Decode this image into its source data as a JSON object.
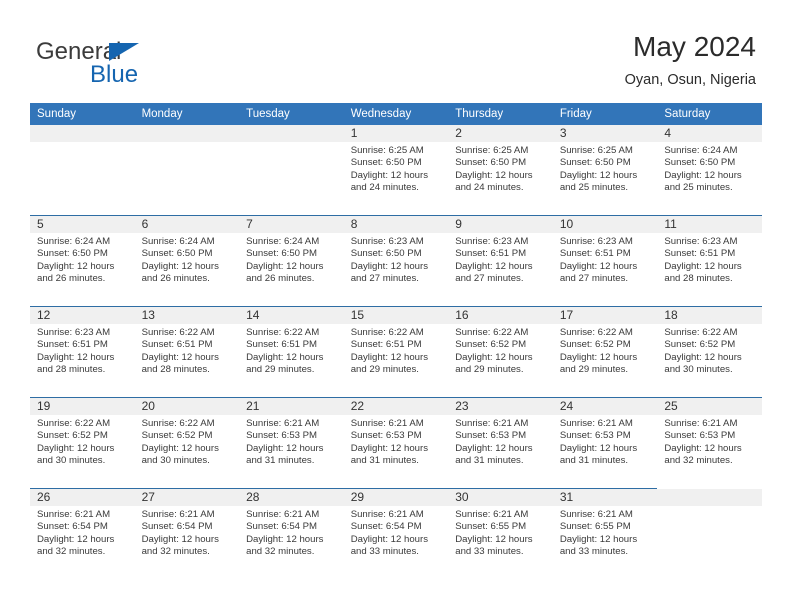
{
  "brand": {
    "word_one": "General",
    "word_two": "Blue",
    "triangle_icon": "triangle-icon",
    "color_blue": "#1565b0"
  },
  "header": {
    "title": "May 2024",
    "subtitle": "Oyan, Osun, Nigeria"
  },
  "theme": {
    "header_bar": "#3275b9",
    "row_divider": "#2e6da4",
    "daynum_band": "#f0f0f0",
    "text": "#3a3a3a"
  },
  "weekdays": [
    "Sunday",
    "Monday",
    "Tuesday",
    "Wednesday",
    "Thursday",
    "Friday",
    "Saturday"
  ],
  "weeks": [
    [
      {
        "day": "",
        "empty": true,
        "sunrise": "",
        "sunset": "",
        "daylight_line1": "",
        "daylight_line2": ""
      },
      {
        "day": "",
        "empty": true,
        "sunrise": "",
        "sunset": "",
        "daylight_line1": "",
        "daylight_line2": ""
      },
      {
        "day": "",
        "empty": true,
        "sunrise": "",
        "sunset": "",
        "daylight_line1": "",
        "daylight_line2": ""
      },
      {
        "day": "1",
        "empty": false,
        "sunrise": "Sunrise: 6:25 AM",
        "sunset": "Sunset: 6:50 PM",
        "daylight_line1": "Daylight: 12 hours",
        "daylight_line2": "and 24 minutes."
      },
      {
        "day": "2",
        "empty": false,
        "sunrise": "Sunrise: 6:25 AM",
        "sunset": "Sunset: 6:50 PM",
        "daylight_line1": "Daylight: 12 hours",
        "daylight_line2": "and 24 minutes."
      },
      {
        "day": "3",
        "empty": false,
        "sunrise": "Sunrise: 6:25 AM",
        "sunset": "Sunset: 6:50 PM",
        "daylight_line1": "Daylight: 12 hours",
        "daylight_line2": "and 25 minutes."
      },
      {
        "day": "4",
        "empty": false,
        "sunrise": "Sunrise: 6:24 AM",
        "sunset": "Sunset: 6:50 PM",
        "daylight_line1": "Daylight: 12 hours",
        "daylight_line2": "and 25 minutes."
      }
    ],
    [
      {
        "day": "5",
        "empty": false,
        "sunrise": "Sunrise: 6:24 AM",
        "sunset": "Sunset: 6:50 PM",
        "daylight_line1": "Daylight: 12 hours",
        "daylight_line2": "and 26 minutes."
      },
      {
        "day": "6",
        "empty": false,
        "sunrise": "Sunrise: 6:24 AM",
        "sunset": "Sunset: 6:50 PM",
        "daylight_line1": "Daylight: 12 hours",
        "daylight_line2": "and 26 minutes."
      },
      {
        "day": "7",
        "empty": false,
        "sunrise": "Sunrise: 6:24 AM",
        "sunset": "Sunset: 6:50 PM",
        "daylight_line1": "Daylight: 12 hours",
        "daylight_line2": "and 26 minutes."
      },
      {
        "day": "8",
        "empty": false,
        "sunrise": "Sunrise: 6:23 AM",
        "sunset": "Sunset: 6:50 PM",
        "daylight_line1": "Daylight: 12 hours",
        "daylight_line2": "and 27 minutes."
      },
      {
        "day": "9",
        "empty": false,
        "sunrise": "Sunrise: 6:23 AM",
        "sunset": "Sunset: 6:51 PM",
        "daylight_line1": "Daylight: 12 hours",
        "daylight_line2": "and 27 minutes."
      },
      {
        "day": "10",
        "empty": false,
        "sunrise": "Sunrise: 6:23 AM",
        "sunset": "Sunset: 6:51 PM",
        "daylight_line1": "Daylight: 12 hours",
        "daylight_line2": "and 27 minutes."
      },
      {
        "day": "11",
        "empty": false,
        "sunrise": "Sunrise: 6:23 AM",
        "sunset": "Sunset: 6:51 PM",
        "daylight_line1": "Daylight: 12 hours",
        "daylight_line2": "and 28 minutes."
      }
    ],
    [
      {
        "day": "12",
        "empty": false,
        "sunrise": "Sunrise: 6:23 AM",
        "sunset": "Sunset: 6:51 PM",
        "daylight_line1": "Daylight: 12 hours",
        "daylight_line2": "and 28 minutes."
      },
      {
        "day": "13",
        "empty": false,
        "sunrise": "Sunrise: 6:22 AM",
        "sunset": "Sunset: 6:51 PM",
        "daylight_line1": "Daylight: 12 hours",
        "daylight_line2": "and 28 minutes."
      },
      {
        "day": "14",
        "empty": false,
        "sunrise": "Sunrise: 6:22 AM",
        "sunset": "Sunset: 6:51 PM",
        "daylight_line1": "Daylight: 12 hours",
        "daylight_line2": "and 29 minutes."
      },
      {
        "day": "15",
        "empty": false,
        "sunrise": "Sunrise: 6:22 AM",
        "sunset": "Sunset: 6:51 PM",
        "daylight_line1": "Daylight: 12 hours",
        "daylight_line2": "and 29 minutes."
      },
      {
        "day": "16",
        "empty": false,
        "sunrise": "Sunrise: 6:22 AM",
        "sunset": "Sunset: 6:52 PM",
        "daylight_line1": "Daylight: 12 hours",
        "daylight_line2": "and 29 minutes."
      },
      {
        "day": "17",
        "empty": false,
        "sunrise": "Sunrise: 6:22 AM",
        "sunset": "Sunset: 6:52 PM",
        "daylight_line1": "Daylight: 12 hours",
        "daylight_line2": "and 29 minutes."
      },
      {
        "day": "18",
        "empty": false,
        "sunrise": "Sunrise: 6:22 AM",
        "sunset": "Sunset: 6:52 PM",
        "daylight_line1": "Daylight: 12 hours",
        "daylight_line2": "and 30 minutes."
      }
    ],
    [
      {
        "day": "19",
        "empty": false,
        "sunrise": "Sunrise: 6:22 AM",
        "sunset": "Sunset: 6:52 PM",
        "daylight_line1": "Daylight: 12 hours",
        "daylight_line2": "and 30 minutes."
      },
      {
        "day": "20",
        "empty": false,
        "sunrise": "Sunrise: 6:22 AM",
        "sunset": "Sunset: 6:52 PM",
        "daylight_line1": "Daylight: 12 hours",
        "daylight_line2": "and 30 minutes."
      },
      {
        "day": "21",
        "empty": false,
        "sunrise": "Sunrise: 6:21 AM",
        "sunset": "Sunset: 6:53 PM",
        "daylight_line1": "Daylight: 12 hours",
        "daylight_line2": "and 31 minutes."
      },
      {
        "day": "22",
        "empty": false,
        "sunrise": "Sunrise: 6:21 AM",
        "sunset": "Sunset: 6:53 PM",
        "daylight_line1": "Daylight: 12 hours",
        "daylight_line2": "and 31 minutes."
      },
      {
        "day": "23",
        "empty": false,
        "sunrise": "Sunrise: 6:21 AM",
        "sunset": "Sunset: 6:53 PM",
        "daylight_line1": "Daylight: 12 hours",
        "daylight_line2": "and 31 minutes."
      },
      {
        "day": "24",
        "empty": false,
        "sunrise": "Sunrise: 6:21 AM",
        "sunset": "Sunset: 6:53 PM",
        "daylight_line1": "Daylight: 12 hours",
        "daylight_line2": "and 31 minutes."
      },
      {
        "day": "25",
        "empty": false,
        "sunrise": "Sunrise: 6:21 AM",
        "sunset": "Sunset: 6:53 PM",
        "daylight_line1": "Daylight: 12 hours",
        "daylight_line2": "and 32 minutes."
      }
    ],
    [
      {
        "day": "26",
        "empty": false,
        "sunrise": "Sunrise: 6:21 AM",
        "sunset": "Sunset: 6:54 PM",
        "daylight_line1": "Daylight: 12 hours",
        "daylight_line2": "and 32 minutes."
      },
      {
        "day": "27",
        "empty": false,
        "sunrise": "Sunrise: 6:21 AM",
        "sunset": "Sunset: 6:54 PM",
        "daylight_line1": "Daylight: 12 hours",
        "daylight_line2": "and 32 minutes."
      },
      {
        "day": "28",
        "empty": false,
        "sunrise": "Sunrise: 6:21 AM",
        "sunset": "Sunset: 6:54 PM",
        "daylight_line1": "Daylight: 12 hours",
        "daylight_line2": "and 32 minutes."
      },
      {
        "day": "29",
        "empty": false,
        "sunrise": "Sunrise: 6:21 AM",
        "sunset": "Sunset: 6:54 PM",
        "daylight_line1": "Daylight: 12 hours",
        "daylight_line2": "and 33 minutes."
      },
      {
        "day": "30",
        "empty": false,
        "sunrise": "Sunrise: 6:21 AM",
        "sunset": "Sunset: 6:55 PM",
        "daylight_line1": "Daylight: 12 hours",
        "daylight_line2": "and 33 minutes."
      },
      {
        "day": "31",
        "empty": false,
        "sunrise": "Sunrise: 6:21 AM",
        "sunset": "Sunset: 6:55 PM",
        "daylight_line1": "Daylight: 12 hours",
        "daylight_line2": "and 33 minutes."
      },
      {
        "day": "",
        "empty": true,
        "sunrise": "",
        "sunset": "",
        "daylight_line1": "",
        "daylight_line2": ""
      }
    ]
  ]
}
